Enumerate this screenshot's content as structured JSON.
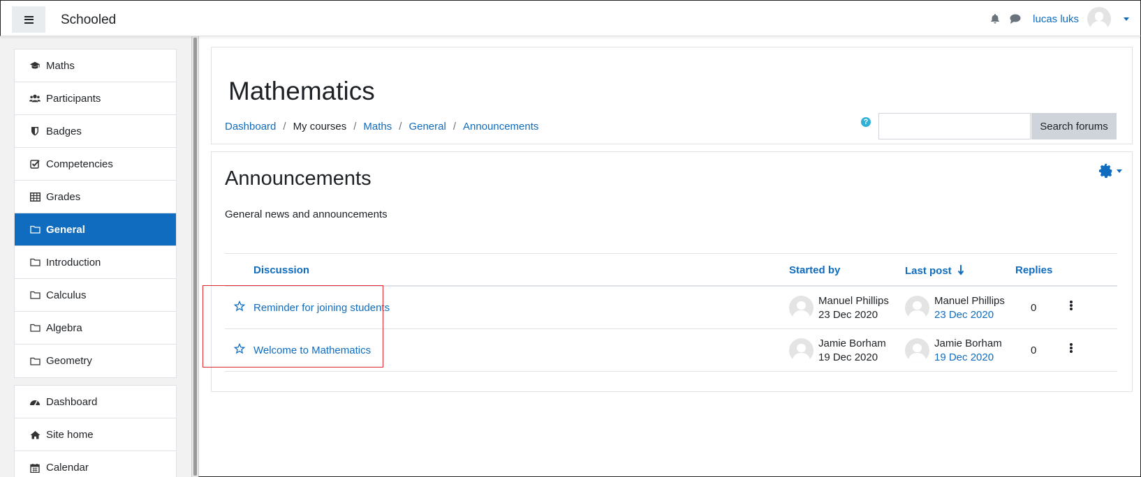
{
  "navbar": {
    "site_name": "Schooled",
    "user_name": "lucas luks",
    "icons": [
      "menu-icon",
      "bell-icon",
      "chat-icon",
      "avatar",
      "chevron-down-icon"
    ]
  },
  "drawer": {
    "course_items": [
      {
        "label": "Maths",
        "icon": "graduation-cap-icon"
      },
      {
        "label": "Participants",
        "icon": "users-icon"
      },
      {
        "label": "Badges",
        "icon": "shield-icon"
      },
      {
        "label": "Competencies",
        "icon": "check-square-icon"
      },
      {
        "label": "Grades",
        "icon": "table-icon"
      },
      {
        "label": "General",
        "icon": "folder-icon",
        "active": true
      },
      {
        "label": "Introduction",
        "icon": "folder-icon"
      },
      {
        "label": "Calculus",
        "icon": "folder-icon"
      },
      {
        "label": "Algebra",
        "icon": "folder-icon"
      },
      {
        "label": "Geometry",
        "icon": "folder-icon"
      }
    ],
    "site_items": [
      {
        "label": "Dashboard",
        "icon": "dashboard-icon"
      },
      {
        "label": "Site home",
        "icon": "home-icon"
      },
      {
        "label": "Calendar",
        "icon": "calendar-icon"
      }
    ]
  },
  "header": {
    "title": "Mathematics",
    "breadcrumb": [
      "Dashboard",
      "My courses",
      "Maths",
      "General",
      "Announcements"
    ],
    "search_button": "Search forums",
    "search_value": ""
  },
  "forum": {
    "title": "Announcements",
    "intro": "General news and announcements",
    "columns": {
      "discussion": "Discussion",
      "started_by": "Started by",
      "last_post": "Last post",
      "replies": "Replies"
    },
    "rows": [
      {
        "title": "Reminder for joining students",
        "started_by": "Manuel Phillips",
        "started_date": "23 Dec 2020",
        "last_post_by": "Manuel Phillips",
        "last_post_date": "23 Dec 2020",
        "replies": "0"
      },
      {
        "title": "Welcome to Mathematics",
        "started_by": "Jamie Borham",
        "started_date": "19 Dec 2020",
        "last_post_by": "Jamie Borham",
        "last_post_date": "19 Dec 2020",
        "replies": "0"
      }
    ]
  },
  "colors": {
    "link": "#0f6cbf",
    "active_bg": "#0f6cbf",
    "highlight": "#e0262e",
    "help": "#31b0d5"
  }
}
